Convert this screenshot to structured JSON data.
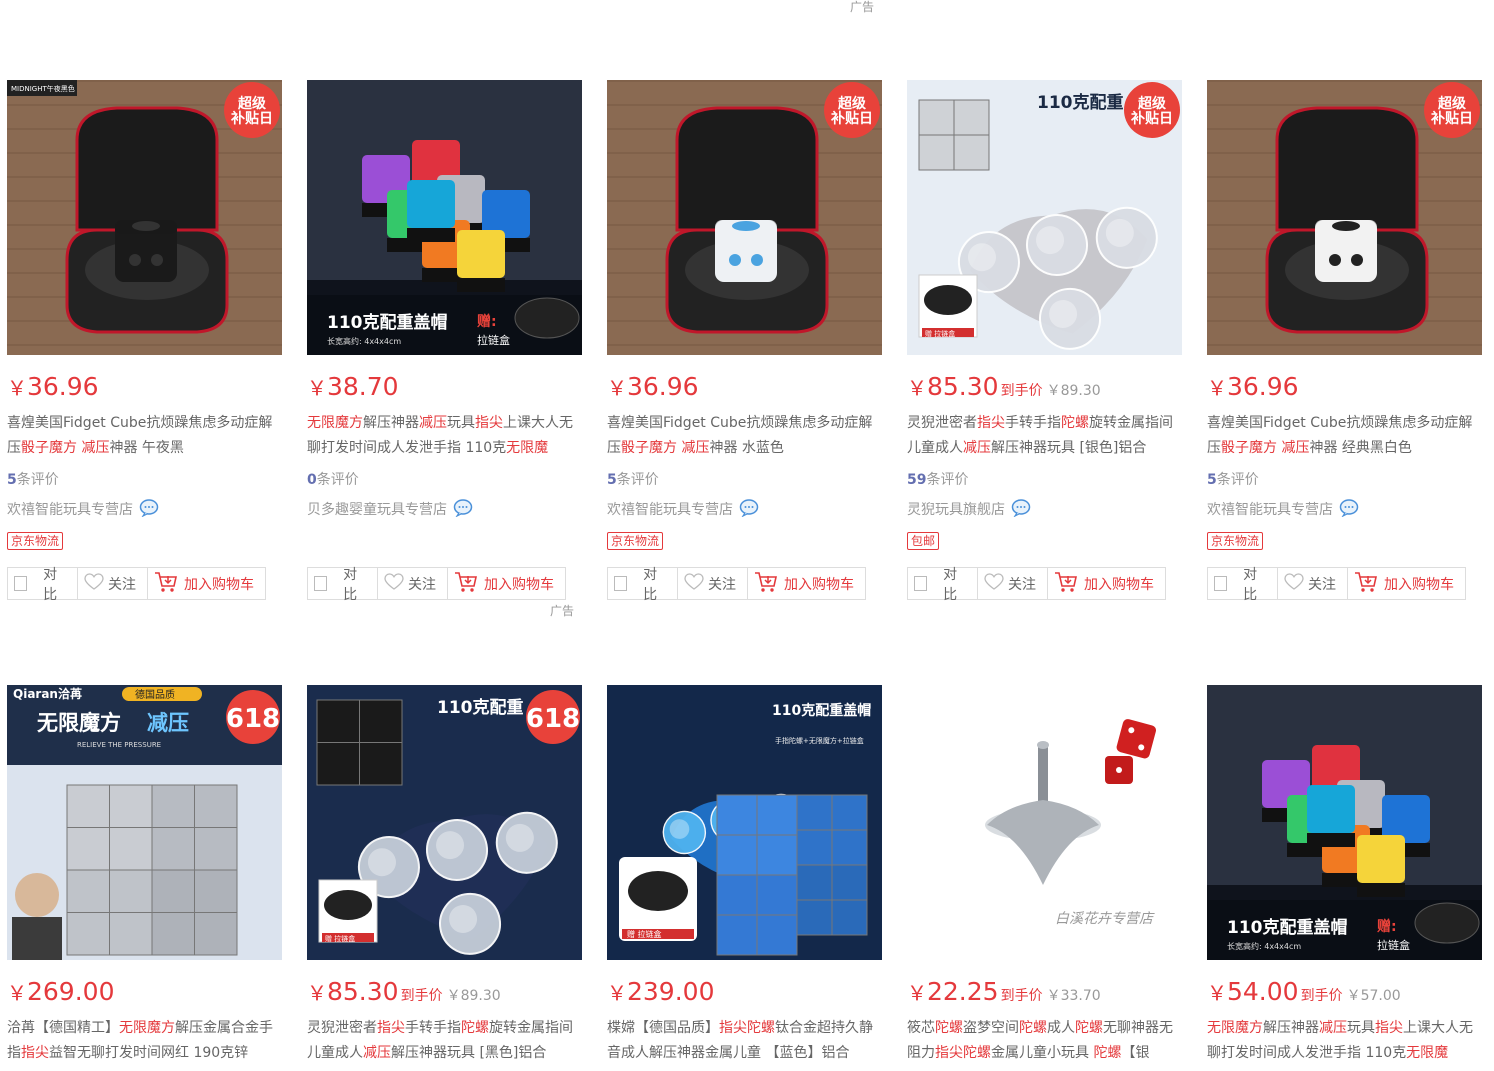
{
  "ad_label": "广告",
  "labels": {
    "compare": "对比",
    "follow": "关注",
    "cart": "加入购物车",
    "reviews_suffix": "条评价",
    "to_hand": "到手价"
  },
  "accent": "#e4393c",
  "row1": [
    {
      "price": "36.96",
      "title_parts": [
        [
          "喜煌美国Fidget Cube抗烦躁焦虑多动症解压",
          0
        ],
        [
          "骰子魔方",
          1
        ],
        [
          " ",
          0
        ],
        [
          "减压",
          1
        ],
        [
          "神器 午夜黑",
          0
        ]
      ],
      "reviews": "5",
      "shop": "欢禧智能玩具专营店",
      "badge": "京东物流"
    },
    {
      "price": "38.70",
      "title_parts": [
        [
          "无限魔方",
          1
        ],
        [
          "解压神器",
          0
        ],
        [
          "减压",
          1
        ],
        [
          "玩具",
          0
        ],
        [
          "指尖",
          1
        ],
        [
          "上课大人无聊打发时间成人发泄手指 110克",
          0
        ],
        [
          "无限魔",
          1
        ]
      ],
      "reviews": "0",
      "shop": "贝多趣婴童玩具专营店",
      "badge": ""
    },
    {
      "price": "36.96",
      "title_parts": [
        [
          "喜煌美国Fidget Cube抗烦躁焦虑多动症解压",
          0
        ],
        [
          "骰子魔方",
          1
        ],
        [
          " ",
          0
        ],
        [
          "减压",
          1
        ],
        [
          "神器 水蓝色",
          0
        ]
      ],
      "reviews": "5",
      "shop": "欢禧智能玩具专营店",
      "badge": "京东物流"
    },
    {
      "price": "85.30",
      "hand": true,
      "orig": "￥89.30",
      "title_parts": [
        [
          "灵猊泄密者",
          0
        ],
        [
          "指尖",
          1
        ],
        [
          "手转手指",
          0
        ],
        [
          "陀螺",
          1
        ],
        [
          "旋转金属指间儿童成人",
          0
        ],
        [
          "减压",
          1
        ],
        [
          "解压神器玩具 [银色]铝合",
          0
        ]
      ],
      "reviews": "59",
      "shop": "灵猊玩具旗舰店",
      "badge": "包邮"
    },
    {
      "price": "36.96",
      "title_parts": [
        [
          "喜煌美国Fidget Cube抗烦躁焦虑多动症解压",
          0
        ],
        [
          "骰子魔方",
          1
        ],
        [
          " ",
          0
        ],
        [
          "减压",
          1
        ],
        [
          "神器 经典黑白色",
          0
        ]
      ],
      "reviews": "5",
      "shop": "欢禧智能玩具专营店",
      "badge": "京东物流"
    }
  ],
  "row2": [
    {
      "price": "269.00",
      "title_parts": [
        [
          "洽苒【德国精工】",
          0
        ],
        [
          "无限魔方",
          1
        ],
        [
          "解压金属合金手指",
          0
        ],
        [
          "指尖",
          1
        ],
        [
          "益智无聊打发时间网红 190克锌",
          0
        ]
      ]
    },
    {
      "price": "85.30",
      "hand": true,
      "orig": "￥89.30",
      "title_parts": [
        [
          "灵猊泄密者",
          0
        ],
        [
          "指尖",
          1
        ],
        [
          "手转手指",
          0
        ],
        [
          "陀螺",
          1
        ],
        [
          "旋转金属指间儿童成人",
          0
        ],
        [
          "减压",
          1
        ],
        [
          "解压神器玩具 [黑色]铝合",
          0
        ]
      ]
    },
    {
      "price": "239.00",
      "title_parts": [
        [
          "楪嫦【德国品质】",
          0
        ],
        [
          "指尖陀螺",
          1
        ],
        [
          "钛合金超持久静音成人解压神器金属儿童 【蓝色】铝合",
          0
        ]
      ]
    },
    {
      "price": "22.25",
      "hand": true,
      "orig": "￥33.70",
      "title_parts": [
        [
          "筱芯",
          0
        ],
        [
          "陀螺",
          1
        ],
        [
          "盗梦空间",
          0
        ],
        [
          "陀螺",
          1
        ],
        [
          "成人",
          0
        ],
        [
          "陀螺",
          1
        ],
        [
          "无聊神器无阻力",
          0
        ],
        [
          "指尖陀螺",
          1
        ],
        [
          "金属儿童小玩具 ",
          0
        ],
        [
          "陀螺",
          1
        ],
        [
          "【银",
          0
        ]
      ]
    },
    {
      "price": "54.00",
      "hand": true,
      "orig": "￥57.00",
      "title_parts": [
        [
          "无限魔方",
          1
        ],
        [
          "解压神器",
          0
        ],
        [
          "减压",
          1
        ],
        [
          "玩具",
          0
        ],
        [
          "指尖",
          1
        ],
        [
          "上课大人无聊打发时间成人发泄手指 110克",
          0
        ],
        [
          "无限魔",
          1
        ]
      ]
    }
  ],
  "images": {
    "r1": [
      "cube-black-case",
      "infinity-cube-colorful",
      "cube-blue-case",
      "spinner-silver",
      "cube-white-case"
    ],
    "r2": [
      "infinity-cube-silver",
      "spinner-dark-blue",
      "spinner-blue-cube",
      "spinning-top",
      "infinity-cube-colorful"
    ]
  },
  "overlay_text": {
    "super": [
      "超级",
      "补贴日"
    ],
    "midnight": "MIDNIGHT午夜黑色",
    "g110": "110克配重盖帽",
    "g110short": "110克配重",
    "gift": "赠:",
    "zip": "拉链盒",
    "size": "长宽高约: 4x4x4cm",
    "s618": "618",
    "brand": "Qiaran洽苒",
    "brand_q": "德国品质",
    "infinite": "无限魔方",
    "relief": "减压",
    "pressure": "RELIEVE THE PRESSURE",
    "shopmark": "白溪花卉专营店",
    "gifttag": "赠 拉链盒",
    "spin_sub": "手指陀螺+无限魔方+拉链盒"
  }
}
